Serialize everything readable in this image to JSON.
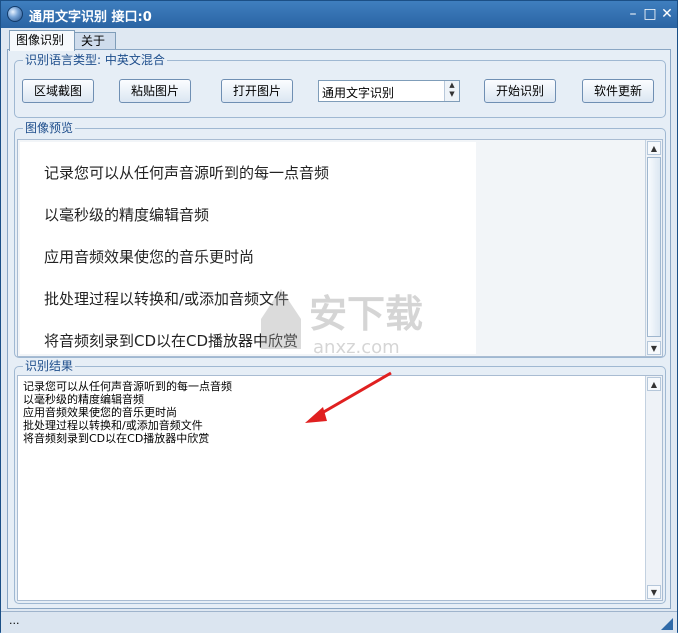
{
  "window": {
    "title": "通用文字识别 接口:0",
    "minimize_glyph": "–",
    "maximize_glyph": "□",
    "close_glyph": "✕",
    "app_icon": "orb-icon"
  },
  "tabs": [
    {
      "label": "图像识别",
      "active": true
    },
    {
      "label": "关于",
      "active": false
    }
  ],
  "language_group": {
    "label": "识别语言类型: 中英文混合"
  },
  "toolbar": {
    "region_capture": "区域截图",
    "paste_image": "粘贴图片",
    "open_image": "打开图片",
    "mode_select_value": "通用文字识别",
    "start_recognition": "开始识别",
    "software_update": "软件更新"
  },
  "preview": {
    "label": "图像预览",
    "lines": [
      "记录您可以从任何声音源听到的每一点音频",
      "以毫秒级的精度编辑音频",
      "应用音频效果使您的音乐更时尚",
      "批处理过程以转换和/或添加音频文件",
      "将音频刻录到CD以在CD播放器中欣赏"
    ]
  },
  "result": {
    "label": "识别结果",
    "text": "记录您可以从任何声音源听到的每一点音频\n以毫秒级的精度编辑音频\n应用音频效果使您的音乐更时尚\n批处理过程以转换和/或添加音频文件\n将音频刻录到CD以在CD播放器中欣赏"
  },
  "status": {
    "text": "..."
  },
  "watermark": {
    "text": "安下载",
    "sub": "anxz.com"
  },
  "colors": {
    "title_bar": "#2a64a3",
    "group_label": "#1e4e8c",
    "annotation_arrow": "#e02020"
  }
}
